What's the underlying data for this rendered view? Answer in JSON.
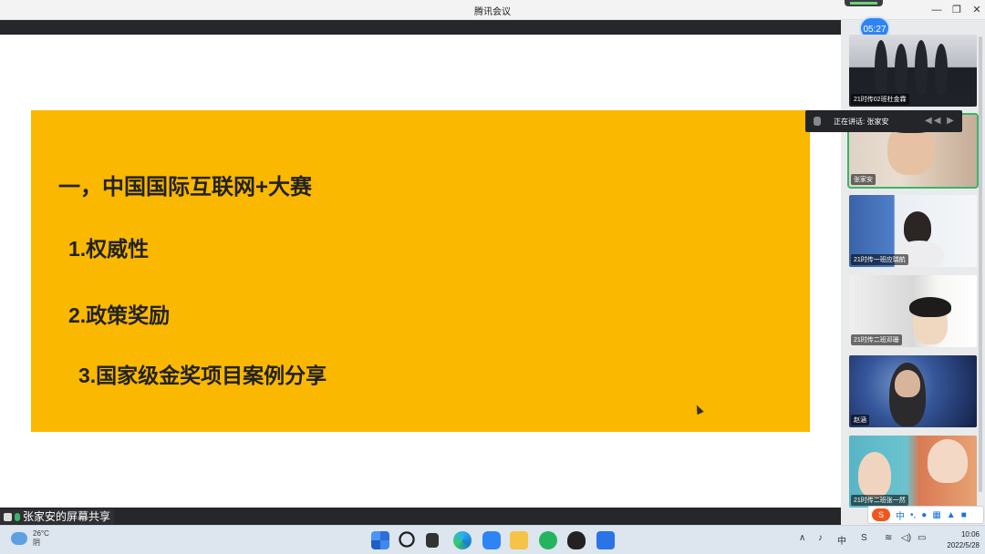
{
  "window": {
    "title": "腾讯会议",
    "min": "—",
    "max": "❐",
    "close": "✕"
  },
  "slide": {
    "heading": "一，中国国际互联网+大赛",
    "items": [
      "1.权威性",
      "2.政策奖励",
      "3.国家级金奖项目案例分享"
    ],
    "bg_color": "#fbb800"
  },
  "share_label": "张家安的屏幕共享",
  "timer": "05:27",
  "speaking": {
    "text": "正在讲话: 张家安"
  },
  "participants": [
    {
      "name": "21时传02班杜金霖"
    },
    {
      "name": "张家安"
    },
    {
      "name": "21时传一班应瑞航"
    },
    {
      "name": "21时传二班邓珊"
    },
    {
      "name": "赵涵"
    },
    {
      "name": "21时传二班张一然"
    }
  ],
  "taskbar": {
    "weather_temp": "26°C",
    "weather_desc": "阴",
    "time": "10:06",
    "date": "2022/5/28",
    "ime_label": "中",
    "tray_up": "∧"
  },
  "colors": {
    "accent": "#2f84f4",
    "active_border": "#39b56a"
  }
}
